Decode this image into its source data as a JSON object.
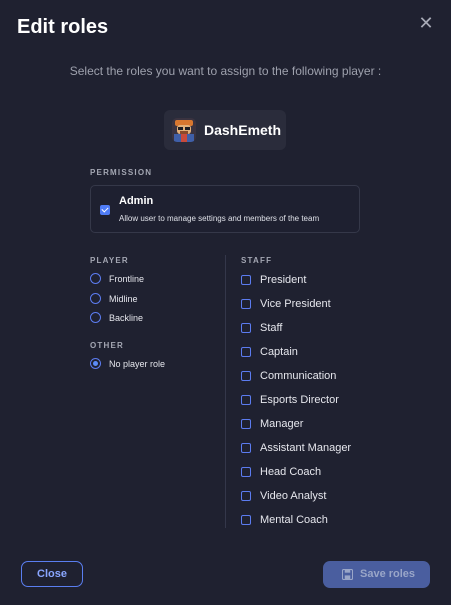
{
  "dialog": {
    "title": "Edit roles",
    "subtitle": "Select the roles you want to assign to the following player :"
  },
  "player": {
    "name": "DashEmeth"
  },
  "permission": {
    "section_label": "PERMISSION",
    "title": "Admin",
    "description": "Allow user to manage settings and members of the team",
    "checked": true
  },
  "player_roles": {
    "section_label": "PLAYER",
    "options": [
      {
        "label": "Frontline",
        "checked": false
      },
      {
        "label": "Midline",
        "checked": false
      },
      {
        "label": "Backline",
        "checked": false
      }
    ]
  },
  "other_roles": {
    "section_label": "OTHER",
    "options": [
      {
        "label": "No player role",
        "checked": true
      }
    ]
  },
  "staff_roles": {
    "section_label": "STAFF",
    "options": [
      {
        "label": "President",
        "checked": false
      },
      {
        "label": "Vice President",
        "checked": false
      },
      {
        "label": "Staff",
        "checked": false
      },
      {
        "label": "Captain",
        "checked": false
      },
      {
        "label": "Communication",
        "checked": false
      },
      {
        "label": "Esports Director",
        "checked": false
      },
      {
        "label": "Manager",
        "checked": false
      },
      {
        "label": "Assistant Manager",
        "checked": false
      },
      {
        "label": "Head Coach",
        "checked": false
      },
      {
        "label": "Video Analyst",
        "checked": false
      },
      {
        "label": "Mental Coach",
        "checked": false
      }
    ]
  },
  "footer": {
    "close_label": "Close",
    "save_label": "Save roles"
  },
  "icons": {
    "close": "close-icon",
    "save": "floppy-disk-icon",
    "avatar": "player-avatar"
  },
  "colors": {
    "background": "#1f2130",
    "accent": "#4f7cf6",
    "save_button": "#4a5e9f"
  }
}
